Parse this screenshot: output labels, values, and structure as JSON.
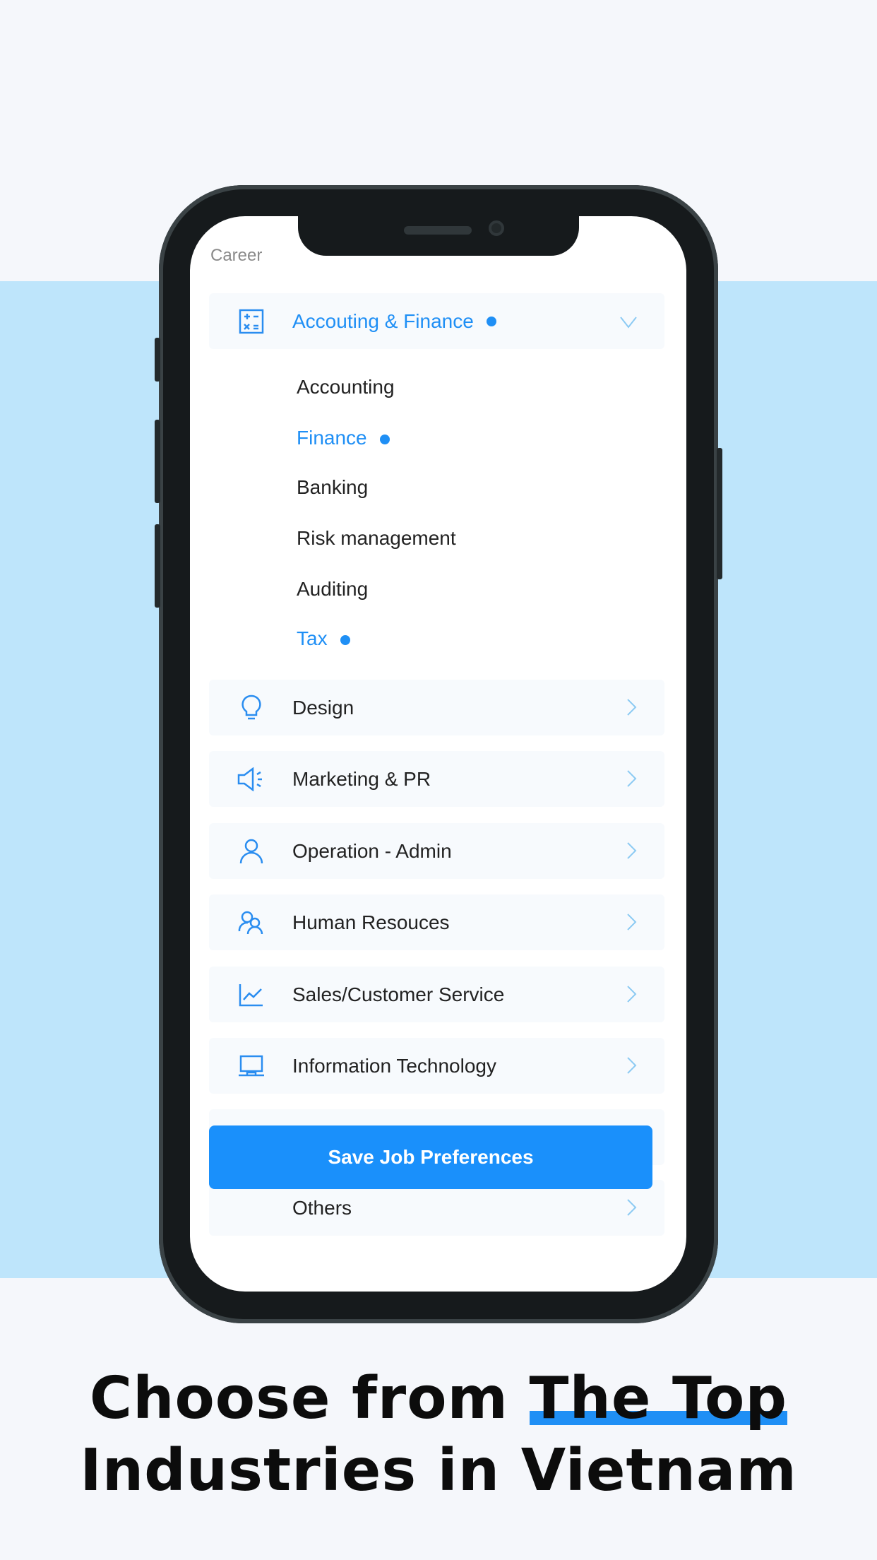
{
  "screen": {
    "section_title": "Career",
    "expanded_category": {
      "label": "Accouting & Finance",
      "icon": "calculator-icon",
      "selected": true
    },
    "subcategories": [
      {
        "label": "Accounting",
        "selected": false
      },
      {
        "label": "Finance",
        "selected": true
      },
      {
        "label": "Banking",
        "selected": false
      },
      {
        "label": "Risk management",
        "selected": false
      },
      {
        "label": "Auditing",
        "selected": false
      },
      {
        "label": "Tax",
        "selected": true
      }
    ],
    "categories": [
      {
        "label": "Design",
        "icon": "lightbulb-icon"
      },
      {
        "label": "Marketing & PR",
        "icon": "megaphone-icon"
      },
      {
        "label": "Operation - Admin",
        "icon": "user-icon"
      },
      {
        "label": "Human Resouces",
        "icon": "users-icon"
      },
      {
        "label": "Sales/Customer Service",
        "icon": "chart-line-icon"
      },
      {
        "label": "Information Technology",
        "icon": "laptop-icon"
      },
      {
        "label": "Others",
        "icon": ""
      }
    ],
    "save_button": "Save Job Preferences"
  },
  "headline": {
    "line1_a": "Choose from ",
    "line1_highlight": "The Top",
    "line2": "Industries in Vietnam"
  },
  "colors": {
    "accent": "#1f8ff5",
    "band": "#bee5fb",
    "background": "#f5f7fb"
  }
}
